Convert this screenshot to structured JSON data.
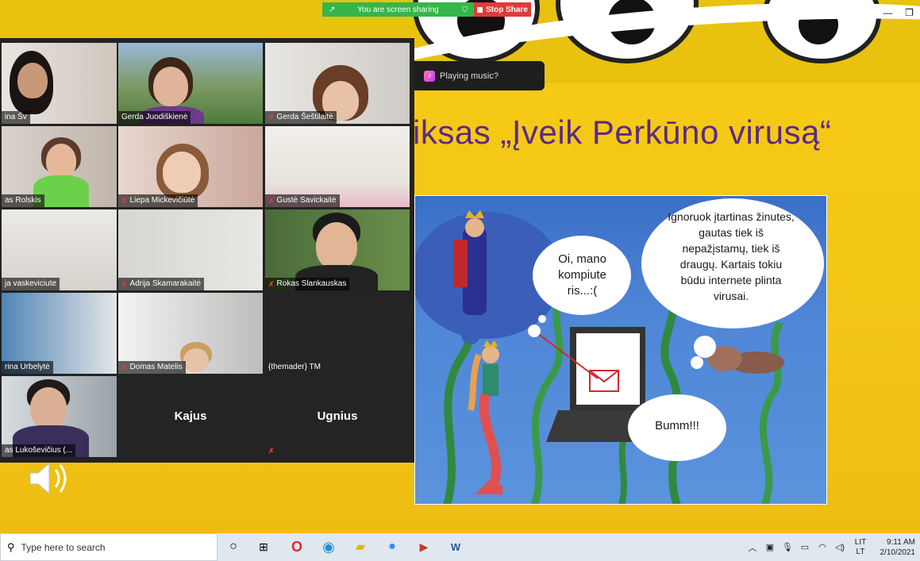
{
  "screen_share": {
    "status_label": "You are screen sharing",
    "stop_label": "Stop Share"
  },
  "toast": {
    "label": "Playing music?"
  },
  "slide": {
    "title": "iksas „Įveik Perkūno virusą“",
    "comic": {
      "bubble_small": "Oi, mano kompiute ris...:(",
      "bubble_large": "Ignoruok įtartinas žinutes, gautas tiek iš nepažįstamų, tiek iš draugų. Kartais tokiu būdu internete plinta virusai.",
      "bubble_bottom": "Bumm!!!"
    }
  },
  "gallery": {
    "participants": [
      {
        "name": "ina Šv"
      },
      {
        "name": "Gerda Juodiškienė"
      },
      {
        "name": "Gerda Šeštilaitė"
      },
      {
        "name": "as Rolskis"
      },
      {
        "name": "Liepa Mickevičiūtė"
      },
      {
        "name": "Gustė Savickaitė"
      },
      {
        "name": "ja vaskeviciute"
      },
      {
        "name": "Adrija Skamarakaitė"
      },
      {
        "name": "Rokas Slankauskas"
      },
      {
        "name": "rina Urbelytė"
      },
      {
        "name": "Domas Matelis"
      },
      {
        "name": "{themader} TM"
      },
      {
        "name": "as Lukoševičius (..."
      },
      {
        "name": "Kajus"
      },
      {
        "name": "Ugnius"
      }
    ]
  },
  "taskbar": {
    "search_placeholder": "Type here to search",
    "lang_top": "LIT",
    "lang_bottom": "LT",
    "time": "9:11 AM",
    "date": "2/10/2021"
  },
  "colors": {
    "share_green": "#35b64a",
    "stop_red": "#e23a3a",
    "slide_yellow": "#f3c516",
    "title_purple": "#5b2a86"
  }
}
